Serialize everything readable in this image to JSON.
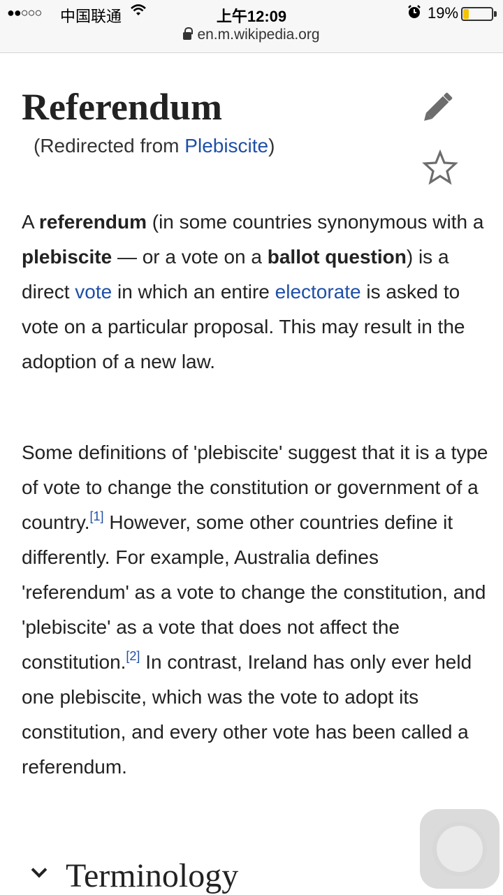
{
  "status_bar": {
    "signal": "●●○○○",
    "carrier": "中国联通",
    "time": "上午12:09",
    "battery": "19%",
    "battery_level": 0.19,
    "battery_color": "#f5c400"
  },
  "url_bar": {
    "url": "en.m.wikipedia.org"
  },
  "article": {
    "title": "Referendum",
    "redirect_prefix": "(Redirected from ",
    "redirect_link": "Plebiscite",
    "redirect_suffix": ")",
    "p1": {
      "t1": "A ",
      "b1": "referendum",
      "t2": " (in some countries synonymous with a ",
      "b2": "plebiscite",
      "t3": " — or a vote on a ",
      "b3": "ballot question",
      "t4": ") is a direct ",
      "l1": "vote",
      "t5": " in which an entire ",
      "l2": "electorate",
      "t6": " is asked to vote on a particular proposal. This may result in the adoption of a new law."
    },
    "p2": {
      "t1": "Some definitions of 'plebiscite' suggest that it is a type of vote to change the constitution or government of a country.",
      "ref1": "[1]",
      "t2": " However, some other countries define it differently. For example, Australia defines 'referendum' as a vote to change the constitution, and 'plebiscite' as a vote that does not affect the constitution.",
      "ref2": "[2]",
      "t3": " In contrast, Ireland has only ever held one plebiscite, which was the vote to adopt its constitution, and every other vote has been called a referendum."
    },
    "section_heading": "Terminology"
  },
  "colors": {
    "link": "#1f4fa6",
    "text": "#222222"
  },
  "icons": [
    "lock-icon",
    "edit-pencil-icon",
    "watch-star-icon",
    "chevron-down-icon",
    "wifi-icon",
    "alarm-icon"
  ]
}
